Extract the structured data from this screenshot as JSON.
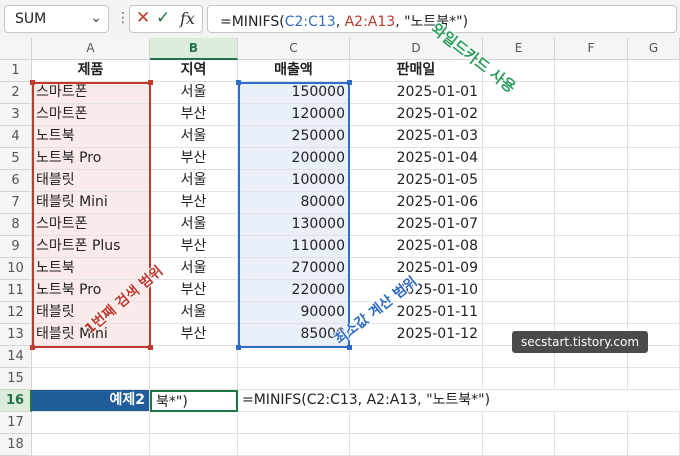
{
  "formula_bar": {
    "name_box": "SUM",
    "cancel_icon": "✕",
    "enter_icon": "✓",
    "fx_label": "fx",
    "formula_parts": [
      "=MINIFS(",
      "C2:C13",
      ", ",
      "A2:A13",
      ", \"노트북*\")"
    ]
  },
  "columns": [
    "A",
    "B",
    "C",
    "D",
    "E",
    "F",
    "G"
  ],
  "rows": [
    "1",
    "2",
    "3",
    "4",
    "5",
    "6",
    "7",
    "8",
    "9",
    "10",
    "11",
    "12",
    "13",
    "14",
    "15",
    "16",
    "17",
    "18"
  ],
  "table": {
    "headers": [
      "제품",
      "지역",
      "매출액",
      "판매일"
    ],
    "data": [
      [
        "스마트폰",
        "서울",
        "150000",
        "2025-01-01"
      ],
      [
        "스마트폰",
        "부산",
        "120000",
        "2025-01-02"
      ],
      [
        "노트북",
        "서울",
        "250000",
        "2025-01-03"
      ],
      [
        "노트북 Pro",
        "부산",
        "200000",
        "2025-01-04"
      ],
      [
        "태블릿",
        "서울",
        "100000",
        "2025-01-05"
      ],
      [
        "태블릿 Mini",
        "부산",
        "80000",
        "2025-01-06"
      ],
      [
        "스마트폰",
        "서울",
        "130000",
        "2025-01-07"
      ],
      [
        "스마트폰 Plus",
        "부산",
        "110000",
        "2025-01-08"
      ],
      [
        "노트북",
        "서울",
        "270000",
        "2025-01-09"
      ],
      [
        "노트북 Pro",
        "부산",
        "220000",
        "2025-01-10"
      ],
      [
        "태블릿",
        "서울",
        "90000",
        "2025-01-11"
      ],
      [
        "태블릿 Mini",
        "부산",
        "85000",
        "2025-01-12"
      ]
    ]
  },
  "row16": {
    "label": "예제2",
    "editing_text": "북*\")",
    "formula_text": "=MINIFS(C2:C13, A2:A13, \"노트북*\")"
  },
  "annotations": {
    "wildcard": "와일드카드 사용",
    "search_range": "1번째 검색 범위",
    "min_range": "최소값 계산 범위"
  },
  "watermark": "secstart.tistory.com",
  "colors": {
    "excel_green": "#217346",
    "range_blue": "#2f6cc3",
    "range_red": "#c0392b",
    "label_blue": "#1f5c99"
  }
}
